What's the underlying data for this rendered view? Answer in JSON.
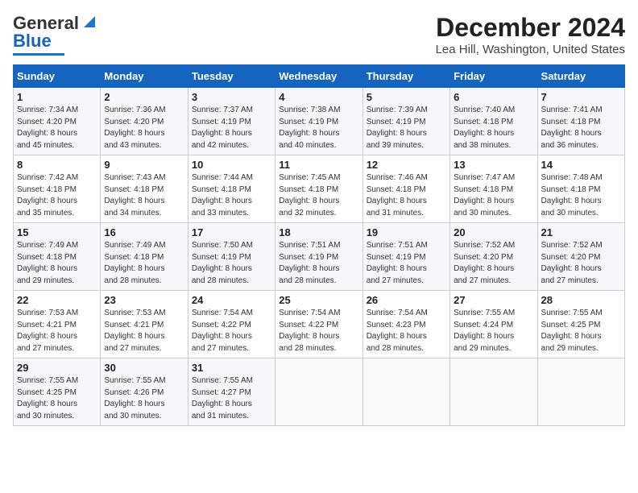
{
  "header": {
    "logo_line1": "General",
    "logo_line2": "Blue",
    "month_title": "December 2024",
    "location": "Lea Hill, Washington, United States"
  },
  "days_of_week": [
    "Sunday",
    "Monday",
    "Tuesday",
    "Wednesday",
    "Thursday",
    "Friday",
    "Saturday"
  ],
  "weeks": [
    [
      {
        "day": "1",
        "info": "Sunrise: 7:34 AM\nSunset: 4:20 PM\nDaylight: 8 hours\nand 45 minutes."
      },
      {
        "day": "2",
        "info": "Sunrise: 7:36 AM\nSunset: 4:20 PM\nDaylight: 8 hours\nand 43 minutes."
      },
      {
        "day": "3",
        "info": "Sunrise: 7:37 AM\nSunset: 4:19 PM\nDaylight: 8 hours\nand 42 minutes."
      },
      {
        "day": "4",
        "info": "Sunrise: 7:38 AM\nSunset: 4:19 PM\nDaylight: 8 hours\nand 40 minutes."
      },
      {
        "day": "5",
        "info": "Sunrise: 7:39 AM\nSunset: 4:19 PM\nDaylight: 8 hours\nand 39 minutes."
      },
      {
        "day": "6",
        "info": "Sunrise: 7:40 AM\nSunset: 4:18 PM\nDaylight: 8 hours\nand 38 minutes."
      },
      {
        "day": "7",
        "info": "Sunrise: 7:41 AM\nSunset: 4:18 PM\nDaylight: 8 hours\nand 36 minutes."
      }
    ],
    [
      {
        "day": "8",
        "info": "Sunrise: 7:42 AM\nSunset: 4:18 PM\nDaylight: 8 hours\nand 35 minutes."
      },
      {
        "day": "9",
        "info": "Sunrise: 7:43 AM\nSunset: 4:18 PM\nDaylight: 8 hours\nand 34 minutes."
      },
      {
        "day": "10",
        "info": "Sunrise: 7:44 AM\nSunset: 4:18 PM\nDaylight: 8 hours\nand 33 minutes."
      },
      {
        "day": "11",
        "info": "Sunrise: 7:45 AM\nSunset: 4:18 PM\nDaylight: 8 hours\nand 32 minutes."
      },
      {
        "day": "12",
        "info": "Sunrise: 7:46 AM\nSunset: 4:18 PM\nDaylight: 8 hours\nand 31 minutes."
      },
      {
        "day": "13",
        "info": "Sunrise: 7:47 AM\nSunset: 4:18 PM\nDaylight: 8 hours\nand 30 minutes."
      },
      {
        "day": "14",
        "info": "Sunrise: 7:48 AM\nSunset: 4:18 PM\nDaylight: 8 hours\nand 30 minutes."
      }
    ],
    [
      {
        "day": "15",
        "info": "Sunrise: 7:49 AM\nSunset: 4:18 PM\nDaylight: 8 hours\nand 29 minutes."
      },
      {
        "day": "16",
        "info": "Sunrise: 7:49 AM\nSunset: 4:18 PM\nDaylight: 8 hours\nand 28 minutes."
      },
      {
        "day": "17",
        "info": "Sunrise: 7:50 AM\nSunset: 4:19 PM\nDaylight: 8 hours\nand 28 minutes."
      },
      {
        "day": "18",
        "info": "Sunrise: 7:51 AM\nSunset: 4:19 PM\nDaylight: 8 hours\nand 28 minutes."
      },
      {
        "day": "19",
        "info": "Sunrise: 7:51 AM\nSunset: 4:19 PM\nDaylight: 8 hours\nand 27 minutes."
      },
      {
        "day": "20",
        "info": "Sunrise: 7:52 AM\nSunset: 4:20 PM\nDaylight: 8 hours\nand 27 minutes."
      },
      {
        "day": "21",
        "info": "Sunrise: 7:52 AM\nSunset: 4:20 PM\nDaylight: 8 hours\nand 27 minutes."
      }
    ],
    [
      {
        "day": "22",
        "info": "Sunrise: 7:53 AM\nSunset: 4:21 PM\nDaylight: 8 hours\nand 27 minutes."
      },
      {
        "day": "23",
        "info": "Sunrise: 7:53 AM\nSunset: 4:21 PM\nDaylight: 8 hours\nand 27 minutes."
      },
      {
        "day": "24",
        "info": "Sunrise: 7:54 AM\nSunset: 4:22 PM\nDaylight: 8 hours\nand 27 minutes."
      },
      {
        "day": "25",
        "info": "Sunrise: 7:54 AM\nSunset: 4:22 PM\nDaylight: 8 hours\nand 28 minutes."
      },
      {
        "day": "26",
        "info": "Sunrise: 7:54 AM\nSunset: 4:23 PM\nDaylight: 8 hours\nand 28 minutes."
      },
      {
        "day": "27",
        "info": "Sunrise: 7:55 AM\nSunset: 4:24 PM\nDaylight: 8 hours\nand 29 minutes."
      },
      {
        "day": "28",
        "info": "Sunrise: 7:55 AM\nSunset: 4:25 PM\nDaylight: 8 hours\nand 29 minutes."
      }
    ],
    [
      {
        "day": "29",
        "info": "Sunrise: 7:55 AM\nSunset: 4:25 PM\nDaylight: 8 hours\nand 30 minutes."
      },
      {
        "day": "30",
        "info": "Sunrise: 7:55 AM\nSunset: 4:26 PM\nDaylight: 8 hours\nand 30 minutes."
      },
      {
        "day": "31",
        "info": "Sunrise: 7:55 AM\nSunset: 4:27 PM\nDaylight: 8 hours\nand 31 minutes."
      },
      {
        "day": "",
        "info": ""
      },
      {
        "day": "",
        "info": ""
      },
      {
        "day": "",
        "info": ""
      },
      {
        "day": "",
        "info": ""
      }
    ]
  ]
}
